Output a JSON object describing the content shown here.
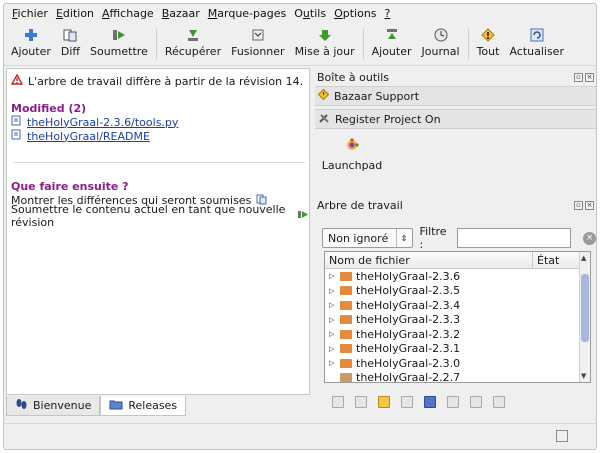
{
  "menubar": [
    {
      "pre": "",
      "key": "F",
      "post": "ichier"
    },
    {
      "pre": "",
      "key": "E",
      "post": "dition"
    },
    {
      "pre": "",
      "key": "A",
      "post": "ffichage"
    },
    {
      "pre": "",
      "key": "B",
      "post": "azaar"
    },
    {
      "pre": "",
      "key": "M",
      "post": "arque-pages"
    },
    {
      "pre": "O",
      "key": "u",
      "post": "tils"
    },
    {
      "pre": "",
      "key": "O",
      "post": "ptions"
    },
    {
      "pre": "",
      "key": "?",
      "post": ""
    }
  ],
  "toolbar": {
    "add": "Ajouter",
    "diff": "Diff",
    "submit": "Soumettre",
    "pull": "Récupérer",
    "merge": "Fusionner",
    "update": "Mise à jour",
    "add2": "Ajouter",
    "log": "Journal",
    "all": "Tout",
    "refresh": "Actualiser"
  },
  "status_panel": {
    "notice": "L'arbre de travail diffère à partir de la révision 14.",
    "modified_title": "Modified (2)",
    "modified_files": [
      "theHolyGraal-2.3.6/tools.py",
      "theHolyGraal/README"
    ],
    "next_title": "Que faire ensuite ?",
    "next_diff": "Montrer les différences qui seront soumises",
    "next_commit": "Soumettre le contenu actuel en tant que nouvelle révision"
  },
  "tabs": {
    "welcome": "Bienvenue",
    "releases": "Releases"
  },
  "toolbox": {
    "title": "Boîte à outils",
    "support": "Bazaar Support",
    "register": "Register Project On",
    "launchpad": "Launchpad"
  },
  "worktree": {
    "title": "Arbre de travail",
    "filter_value": "Non ignoré",
    "filter_label": "Filtre :",
    "filter_text": "",
    "col_name": "Nom de fichier",
    "col_state": "État",
    "rows": [
      "theHolyGraal-2.3.6",
      "theHolyGraal-2.3.5",
      "theHolyGraal-2.3.4",
      "theHolyGraal-2.3.3",
      "theHolyGraal-2.3.2",
      "theHolyGraal-2.3.1",
      "theHolyGraal-2.3.0",
      "theHolyGraal-2.2.7"
    ]
  },
  "colors": {
    "accent_purple": "#8a1f8a",
    "link_blue": "#1a3fa8",
    "folder_orange": "#e58a3c"
  }
}
